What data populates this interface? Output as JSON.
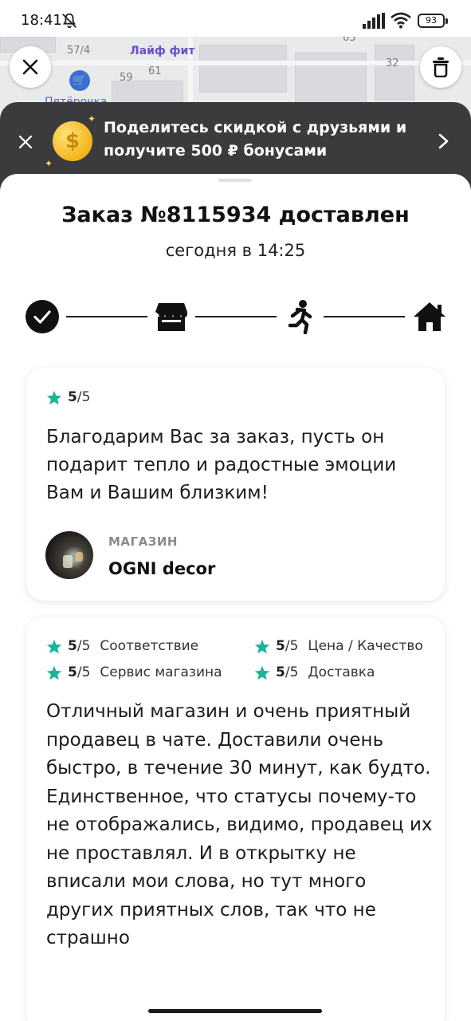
{
  "status_bar": {
    "time": "18:41",
    "battery": "93"
  },
  "map": {
    "labels": [
      "57/4",
      "59",
      "61",
      "63",
      "32"
    ],
    "poi_main": "Лайф фит",
    "poi_secondary": "Пятёрочка"
  },
  "promo": {
    "text": "Поделитесь скидкой с друзьями и получите 500 ₽ бонусами",
    "coin_symbol": "$"
  },
  "order": {
    "title": "Заказ №8115934 доставлен",
    "subtitle": "сегодня в 14:25",
    "steps": [
      "check-icon",
      "store-icon",
      "courier-running-icon",
      "home-icon"
    ]
  },
  "review_shop": {
    "rating_value": "5",
    "rating_max": "/5",
    "text": "Благодарим Вас за заказ, пусть он подарит тепло и радостные эмоции Вам и Вашим близким!",
    "shop_label": "МАГАЗИН",
    "shop_name": "OGNI decor"
  },
  "review_user": {
    "ratings": [
      {
        "value": "5",
        "max": "/5",
        "category": "Соответствие"
      },
      {
        "value": "5",
        "max": "/5",
        "category": "Цена / Качество"
      },
      {
        "value": "5",
        "max": "/5",
        "category": "Сервис магазина"
      },
      {
        "value": "5",
        "max": "/5",
        "category": "Доставка"
      }
    ],
    "text": "Отличный магазин и очень приятный продавец в чате. Доставили очень быстро, в течение 30 минут, как будто. Единственное, что статусы почему-то не отображались, видимо, продавец их не проставлял. И в открытку не вписали мои слова, но тут много других приятных слов, так что не страшно"
  },
  "colors": {
    "star": "#1bb39a",
    "banner_bg": "#3b3b3d",
    "coin": "#f2b51c"
  }
}
